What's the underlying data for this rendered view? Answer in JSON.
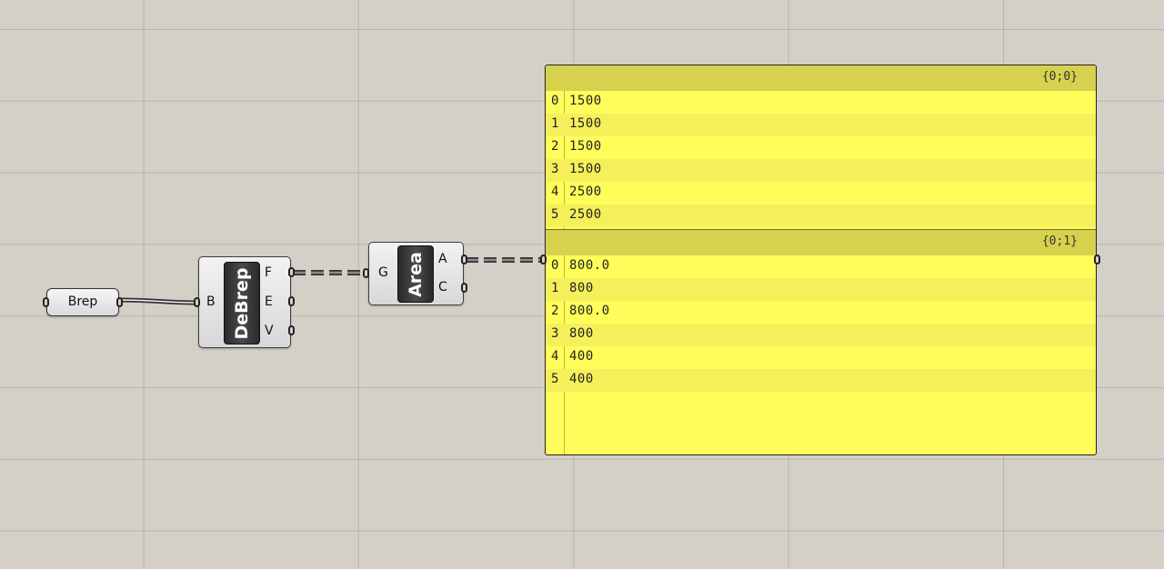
{
  "brep_param": {
    "label": "Brep"
  },
  "debrep": {
    "name": "DeBrep",
    "input": "B",
    "outputs": [
      "F",
      "E",
      "V"
    ]
  },
  "area": {
    "name": "Area",
    "input": "G",
    "outputs": [
      "A",
      "C"
    ]
  },
  "panel": {
    "branches": [
      {
        "path": "{0;0}",
        "items": [
          {
            "index": "0",
            "value": "1500"
          },
          {
            "index": "1",
            "value": "1500"
          },
          {
            "index": "2",
            "value": "1500"
          },
          {
            "index": "3",
            "value": "1500"
          },
          {
            "index": "4",
            "value": "2500"
          },
          {
            "index": "5",
            "value": "2500"
          }
        ]
      },
      {
        "path": "{0;1}",
        "items": [
          {
            "index": "0",
            "value": "800.0"
          },
          {
            "index": "1",
            "value": "800"
          },
          {
            "index": "2",
            "value": "800.0"
          },
          {
            "index": "3",
            "value": "800"
          },
          {
            "index": "4",
            "value": "400"
          },
          {
            "index": "5",
            "value": "400"
          }
        ]
      }
    ]
  },
  "colors": {
    "canvas": "#d4d0c8",
    "panel": "#fffd5a",
    "panel_header": "#d7d24e"
  }
}
